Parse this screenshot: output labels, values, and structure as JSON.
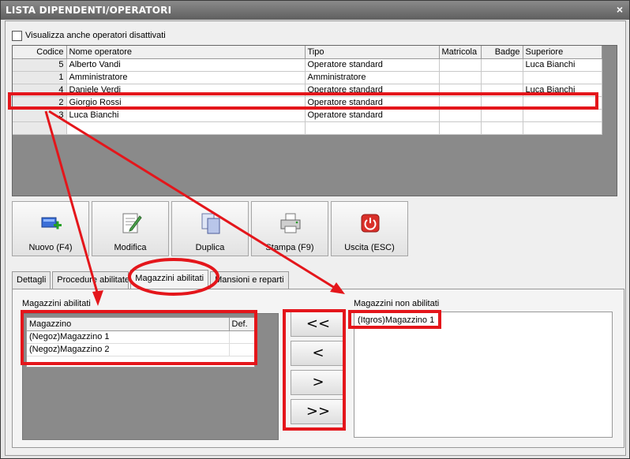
{
  "window": {
    "title": "LISTA DIPENDENTI/OPERATORI",
    "close_glyph": "×"
  },
  "show_disabled_label": "Visualizza anche operatori disattivati",
  "grid": {
    "columns": [
      "Codice",
      "Nome operatore",
      "Tipo",
      "Matricola",
      "Badge",
      "Superiore"
    ],
    "rows": [
      [
        "5",
        "Alberto Vandi",
        "Operatore standard",
        "",
        "",
        "Luca Bianchi"
      ],
      [
        "1",
        "Amministratore",
        "Amministratore",
        "",
        "",
        ""
      ],
      [
        "4",
        "Daniele Verdi",
        "Operatore standard",
        "",
        "",
        "Luca Bianchi"
      ],
      [
        "2",
        "Giorgio Rossi",
        "Operatore standard",
        "",
        "",
        ""
      ],
      [
        "3",
        "Luca Bianchi",
        "Operatore standard",
        "",
        "",
        ""
      ],
      [
        "",
        "",
        "",
        "",
        "",
        ""
      ]
    ]
  },
  "toolbar": {
    "new_label": "Nuovo (F4)",
    "edit_label": "Modifica",
    "duplicate_label": "Duplica",
    "print_label": "Stampa (F9)",
    "exit_label": "Uscita (ESC)"
  },
  "tabs": [
    "Dettagli",
    "Procedure abilitate",
    "Magazzini abilitati",
    "Mansioni e reparti"
  ],
  "enabled_warehouses": {
    "label": "Magazzini abilitati",
    "columns": [
      "Magazzino",
      "Def."
    ],
    "rows": [
      [
        "(Negoz)Magazzino 1",
        ""
      ],
      [
        "(Negoz)Magazzino 2",
        ""
      ]
    ]
  },
  "move_buttons": [
    "<<",
    "<",
    ">",
    ">>"
  ],
  "disabled_warehouses": {
    "label": "Magazzini non abilitati",
    "items": [
      "(Itgros)Magazzino 1"
    ]
  },
  "colors": {
    "annotation": "#e4161b",
    "titlebar": "#6f6f6f"
  }
}
